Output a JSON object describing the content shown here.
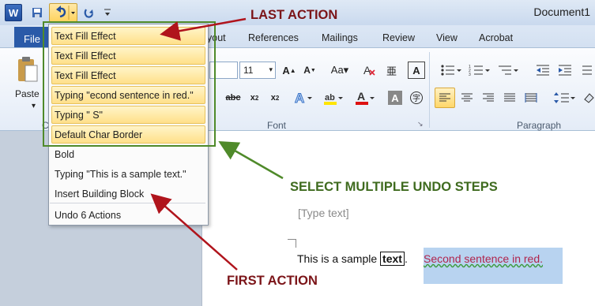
{
  "window": {
    "app_icon_letter": "W",
    "title": "Document1"
  },
  "tabs": {
    "file": "File",
    "items": [
      "yout",
      "References",
      "Mailings",
      "Review",
      "View",
      "Acrobat"
    ]
  },
  "ribbon": {
    "paste_label": "Paste",
    "font_size": "11",
    "group_font": "Font",
    "group_paragraph": "Paragraph",
    "group_clipboard_partial": "C"
  },
  "undo_menu": {
    "items": [
      {
        "label": "Text Fill Effect",
        "selected": true
      },
      {
        "label": "Text Fill Effect",
        "selected": true
      },
      {
        "label": "Text Fill Effect",
        "selected": true
      },
      {
        "label": "Typing \"econd sentence in red.\"",
        "selected": true
      },
      {
        "label": "Typing \" S\"",
        "selected": true
      },
      {
        "label": "Default Char Border",
        "selected": true
      },
      {
        "label": "Bold",
        "selected": false
      },
      {
        "label": "Typing \"This is a sample text.\"",
        "selected": false
      },
      {
        "label": "Insert Building Block",
        "selected": false
      }
    ],
    "footer": "Undo 6 Actions"
  },
  "annotations": {
    "last_action": "LAST ACTION",
    "select_multiple": "SELECT MULTIPLE UNDO STEPS",
    "first_action": "FIRST ACTION"
  },
  "document": {
    "placeholder": "[Type text]",
    "sentence_prefix": "This is a sample ",
    "boxed_word": "text",
    "sentence_suffix": ".",
    "red_sentence": "Second sentence in red."
  },
  "colors": {
    "annotation_red": "#7b1418",
    "annotation_green": "#3f6b1f",
    "red_text": "#b0244c",
    "file_tab": "#2a5aa8"
  }
}
